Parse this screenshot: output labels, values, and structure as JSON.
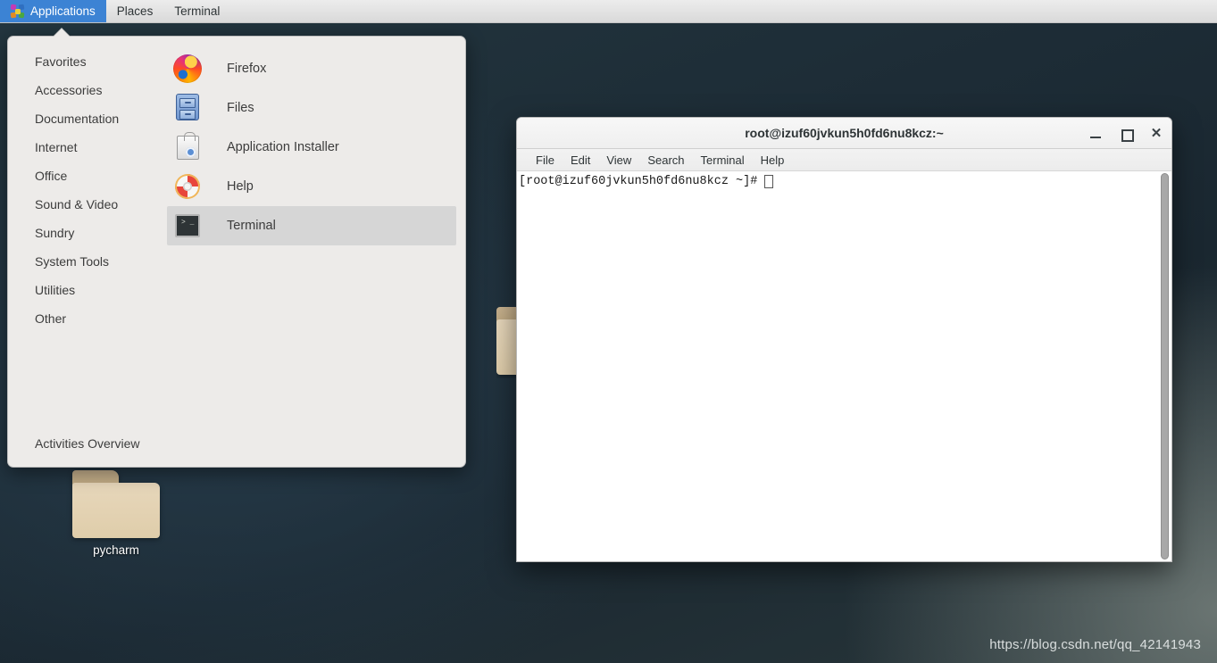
{
  "top_panel": {
    "items": [
      {
        "label": "Applications",
        "icon": "applications-pinwheel-icon",
        "active": true
      },
      {
        "label": "Places",
        "icon": "",
        "active": false
      },
      {
        "label": "Terminal",
        "icon": "",
        "active": false
      }
    ],
    "active_bg": "#3c83d4",
    "bg": "#e5e5e5"
  },
  "apps_menu": {
    "categories": [
      {
        "label": "Favorites"
      },
      {
        "label": "Accessories"
      },
      {
        "label": "Documentation"
      },
      {
        "label": "Internet"
      },
      {
        "label": "Office"
      },
      {
        "label": "Sound & Video"
      },
      {
        "label": "Sundry"
      },
      {
        "label": "System Tools"
      },
      {
        "label": "Utilities"
      },
      {
        "label": "Other"
      }
    ],
    "applications": [
      {
        "label": "Firefox",
        "icon": "firefox-icon",
        "selected": false
      },
      {
        "label": "Files",
        "icon": "files-cabinet-icon",
        "selected": false
      },
      {
        "label": "Application Installer",
        "icon": "application-installer-icon",
        "selected": false
      },
      {
        "label": "Help",
        "icon": "help-lifebuoy-icon",
        "selected": false
      },
      {
        "label": "Terminal",
        "icon": "terminal-icon",
        "selected": true
      }
    ],
    "activities_overview": "Activities Overview",
    "bg": "#edebe9",
    "selected_bg": "#d6d6d6"
  },
  "desktop": {
    "icons": [
      {
        "label": "pycharm",
        "icon": "folder-icon"
      }
    ],
    "hidden_icon": {
      "label": "",
      "icon": "folder-icon"
    },
    "background": "#1d2c36"
  },
  "terminal": {
    "title": "root@izuf60jvkun5h0fd6nu8kcz:~",
    "menu": [
      {
        "label": "File"
      },
      {
        "label": "Edit"
      },
      {
        "label": "View"
      },
      {
        "label": "Search"
      },
      {
        "label": "Terminal"
      },
      {
        "label": "Help"
      }
    ],
    "controls": {
      "minimize": "minimize-icon",
      "maximize": "maximize-icon",
      "close": "✕"
    },
    "prompt": "[root@izuf60jvkun5h0fd6nu8kcz ~]#",
    "bg": "#ffffff",
    "fg": "#1a1a1a"
  },
  "watermark": "https://blog.csdn.net/qq_42141943"
}
